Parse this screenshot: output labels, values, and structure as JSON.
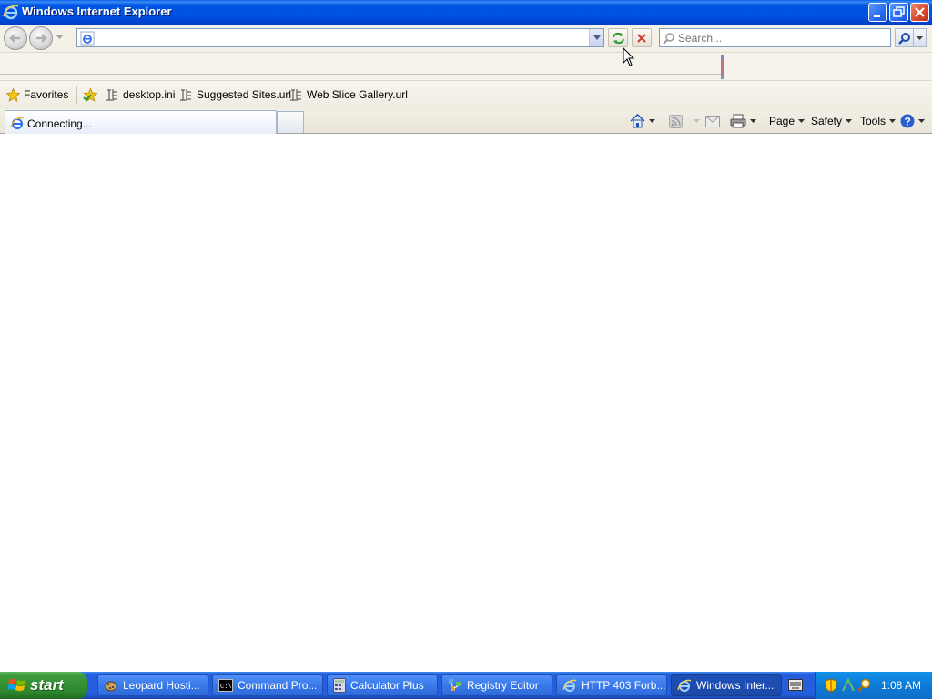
{
  "window": {
    "title": "Windows Internet Explorer"
  },
  "navbar": {
    "address_value": "",
    "search_placeholder": "Search..."
  },
  "favorites": {
    "label": "Favorites",
    "items": [
      {
        "label": "desktop.ini"
      },
      {
        "label": "Suggested Sites.url"
      },
      {
        "label": "Web Slice Gallery.url"
      }
    ]
  },
  "tabs": {
    "active_label": "Connecting..."
  },
  "commandbar": {
    "page_label": "Page",
    "safety_label": "Safety",
    "tools_label": "Tools"
  },
  "taskbar": {
    "start_label": "start",
    "tasks": [
      {
        "label": "Leopard Hosti...",
        "icon": "leopard-icon"
      },
      {
        "label": "Command Pro...",
        "icon": "command-prompt-icon"
      },
      {
        "label": "Calculator Plus",
        "icon": "calculator-icon"
      },
      {
        "label": "Registry Editor",
        "icon": "registry-icon"
      },
      {
        "label": "HTTP 403 Forb...",
        "icon": "ie-icon"
      },
      {
        "label": "Windows Inter...",
        "icon": "ie-icon"
      }
    ],
    "clock": "1:08 AM"
  }
}
